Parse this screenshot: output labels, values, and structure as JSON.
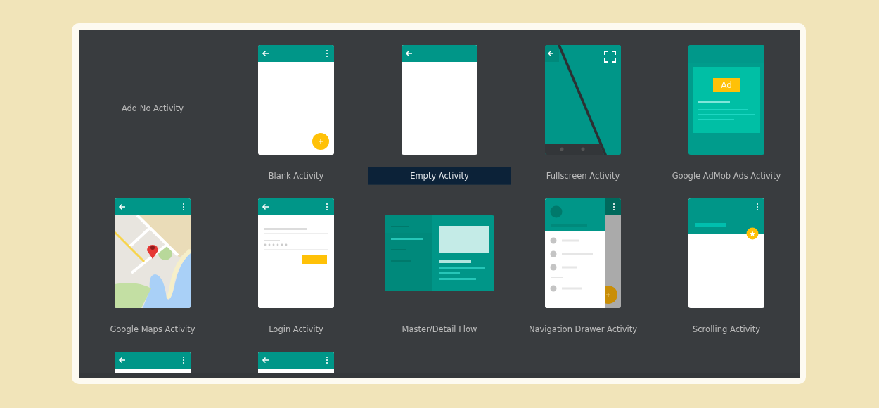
{
  "templates": [
    {
      "kind": "none",
      "label": "Add No Activity",
      "selected": false
    },
    {
      "kind": "blank",
      "label": "Blank Activity",
      "selected": false
    },
    {
      "kind": "empty",
      "label": "Empty Activity",
      "selected": true
    },
    {
      "kind": "fullscreen",
      "label": "Fullscreen Activity",
      "selected": false
    },
    {
      "kind": "admob",
      "label": "Google AdMob Ads Activity",
      "badge": "Ad",
      "selected": false
    },
    {
      "kind": "maps",
      "label": "Google Maps Activity",
      "selected": false
    },
    {
      "kind": "login",
      "label": "Login Activity",
      "selected": false
    },
    {
      "kind": "masterdetail",
      "label": "Master/Detail Flow",
      "selected": false
    },
    {
      "kind": "navdrawer",
      "label": "Navigation Drawer Activity",
      "selected": false
    },
    {
      "kind": "scrolling",
      "label": "Scrolling Activity",
      "selected": false
    },
    {
      "kind": "basic",
      "selected": false
    },
    {
      "kind": "basic",
      "selected": false
    }
  ]
}
